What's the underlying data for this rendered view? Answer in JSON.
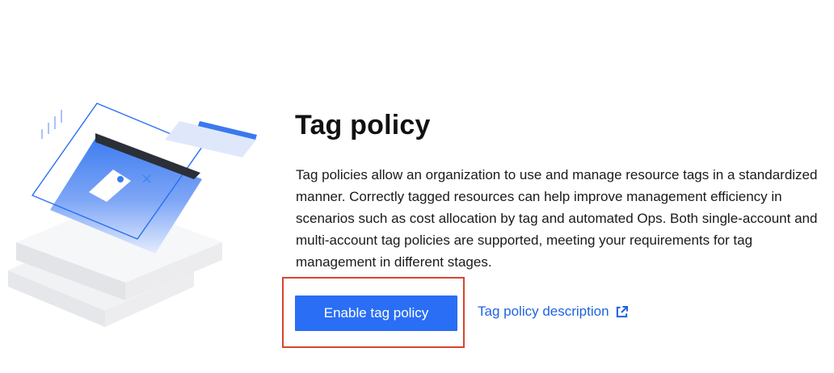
{
  "page": {
    "title": "Tag policy",
    "description": "Tag policies allow an organization to use and manage resource tags in a standardized manner. Correctly tagged resources can help improve management efficiency in scenarios such as cost allocation by tag and automated Ops. Both single-account and multi-account tag policies are supported, meeting your requirements for tag management in different stages."
  },
  "actions": {
    "enable_label": "Enable tag policy",
    "doc_link_label": "Tag policy description",
    "doc_link_icon": "external-link-icon"
  },
  "colors": {
    "primary": "#2a6ef5",
    "link": "#1f63e0",
    "highlight": "#d9442f"
  }
}
